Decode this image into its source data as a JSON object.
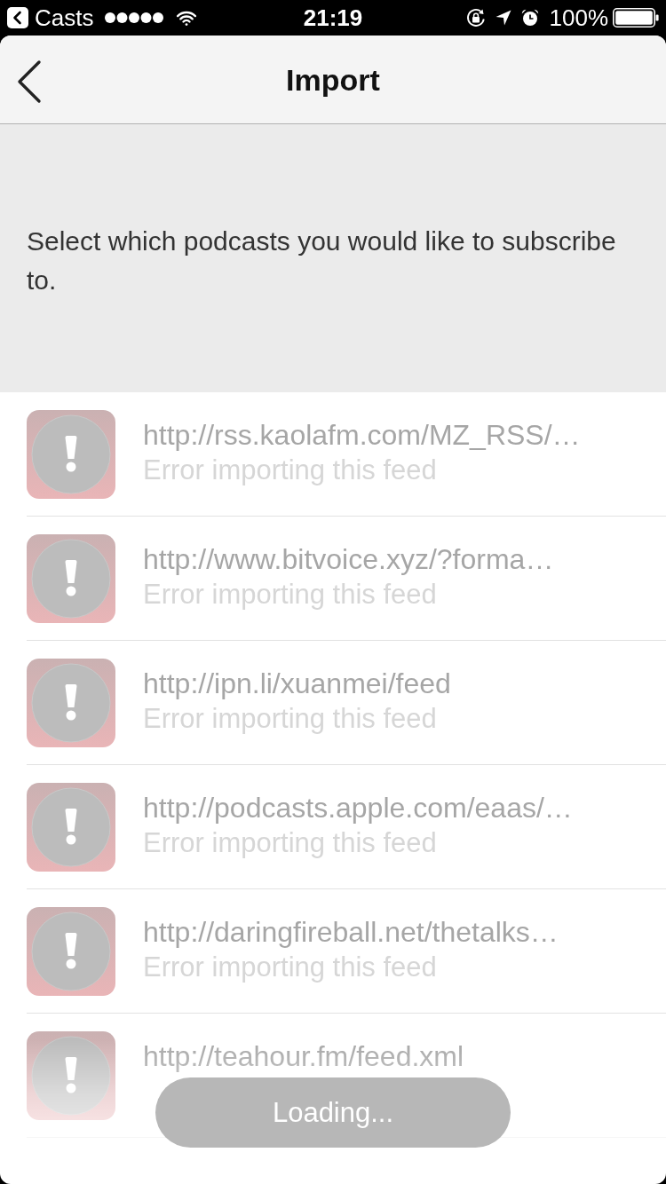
{
  "status_bar": {
    "back_app": "Casts",
    "time": "21:19",
    "battery": "100%"
  },
  "nav": {
    "title": "Import"
  },
  "intro": {
    "text": "Select which podcasts you would like to subscribe to."
  },
  "feeds": [
    {
      "url": "http://rss.kaolafm.com/MZ_RSS/…",
      "message": "Error importing this feed"
    },
    {
      "url": "http://www.bitvoice.xyz/?forma…",
      "message": "Error importing this feed"
    },
    {
      "url": "http://ipn.li/xuanmei/feed",
      "message": "Error importing this feed"
    },
    {
      "url": "http://podcasts.apple.com/eaas/…",
      "message": "Error importing this feed"
    },
    {
      "url": "http://daringfireball.net/thetalks…",
      "message": "Error importing this feed"
    },
    {
      "url": "http://teahour.fm/feed.xml"
    }
  ],
  "toast": {
    "text": "Loading..."
  }
}
